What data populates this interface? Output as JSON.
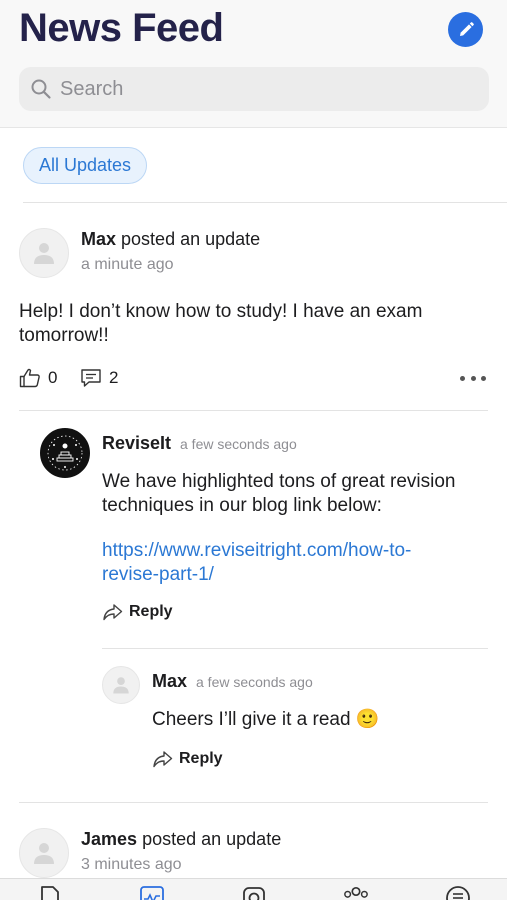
{
  "header": {
    "title": "News Feed",
    "compose_icon": "pencil-icon",
    "search_placeholder": "Search"
  },
  "filter": {
    "label": "All Updates"
  },
  "posts": [
    {
      "author": "Max",
      "action": "posted an update",
      "time": "a minute ago",
      "body": "Help! I don’t know how to study! I have an exam tomorrow!!",
      "likes": "0",
      "comments": "2",
      "replies": [
        {
          "author": "ReviseIt",
          "time": "a few seconds ago",
          "text": "We have highlighted tons of great revision techniques in our blog link below:",
          "link": "https://www.reviseitright.com/how-to-revise-part-1/",
          "reply_label": "Reply"
        },
        {
          "author": "Max",
          "time": "a few seconds ago",
          "text": "Cheers I’ll give it a read",
          "emoji": "🙂",
          "reply_label": "Reply"
        }
      ]
    },
    {
      "author": "James",
      "action": "posted an update",
      "time": "3 minutes ago"
    }
  ],
  "tabbar": {
    "active_color": "#2a6ee0",
    "tabs": [
      {
        "icon": "document-icon"
      },
      {
        "icon": "activity-icon"
      },
      {
        "icon": "camera-icon"
      },
      {
        "icon": "groups-icon"
      },
      {
        "icon": "menu-icon"
      }
    ]
  }
}
